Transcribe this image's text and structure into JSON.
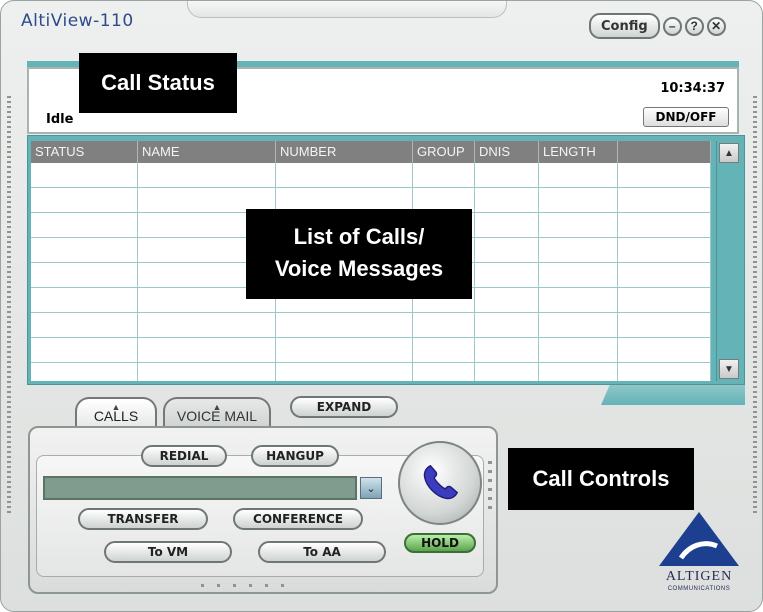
{
  "window": {
    "title": "AltiView-110"
  },
  "top_controls": {
    "config_label": "Config",
    "minimize_symbol": "–",
    "help_symbol": "?",
    "close_symbol": "✕"
  },
  "status": {
    "state": "Idle",
    "time": "10:34:37",
    "dnd_label": "DND/OFF"
  },
  "call_list": {
    "columns": [
      "STATUS",
      "NAME",
      "NUMBER",
      "GROUP",
      "DNIS",
      "LENGTH",
      ""
    ],
    "row_count": 9,
    "rows": []
  },
  "scrollbar": {
    "up_symbol": "▲",
    "down_symbol": "▼"
  },
  "tabs": [
    {
      "label": "CALLS",
      "active": true
    },
    {
      "label": "VOICE MAIL",
      "active": false
    }
  ],
  "expand_label": "EXPAND",
  "controls": {
    "redial_label": "REDIAL",
    "hangup_label": "HANGUP",
    "transfer_label": "TRANSFER",
    "conference_label": "CONFERENCE",
    "to_vm_label": "To VM",
    "to_aa_label": "To AA",
    "hold_label": "HOLD",
    "dial_value": "",
    "dropdown_symbol": "⌄"
  },
  "logo": {
    "name": "ALTIGEN",
    "subtitle": "COMMUNICATIONS"
  },
  "callouts": {
    "call_status": "Call Status",
    "list_line1": "List of Calls/",
    "list_line2": "Voice Messages",
    "call_controls": "Call Controls"
  },
  "colors": {
    "teal": "#64b3b6",
    "title_blue": "#2f4a8c",
    "hold_green": "#5ca44f",
    "header_gray": "#808080"
  },
  "icons": [
    "minimize-icon",
    "help-icon",
    "close-icon",
    "phone-handset-icon",
    "scroll-up-icon",
    "scroll-down-icon",
    "dropdown-arrow-icon",
    "altigen-logo"
  ]
}
